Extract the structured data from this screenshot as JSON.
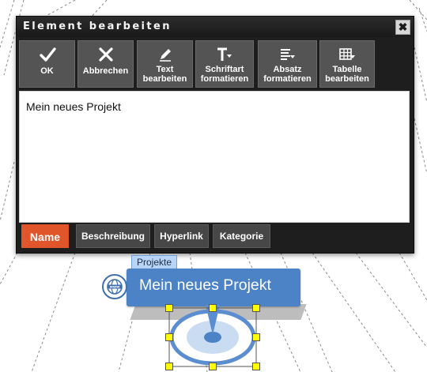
{
  "dialog": {
    "title": "Element bearbeiten",
    "toolbar": [
      {
        "id": "ok",
        "icon": "checkmark-icon",
        "label": "OK"
      },
      {
        "id": "cancel",
        "icon": "close-x-icon",
        "label": "Abbrechen"
      },
      {
        "id": "edit-text",
        "icon": "pencil-icon",
        "label": "Text\nbearbeiten"
      },
      {
        "id": "font-format",
        "icon": "text-format-icon",
        "label": "Schriftart\nformatieren"
      },
      {
        "id": "paragraph-format",
        "icon": "paragraph-format-icon",
        "label": "Absatz\nformatieren"
      },
      {
        "id": "edit-table",
        "icon": "table-icon",
        "label": "Tabelle\nbearbeiten"
      }
    ],
    "editor_text": "Mein neues Projekt",
    "tabs": [
      {
        "label": "Name",
        "active": true
      },
      {
        "label": "Beschreibung",
        "active": false
      },
      {
        "label": "Hyperlink",
        "active": false
      },
      {
        "label": "Kategorie",
        "active": false
      }
    ]
  },
  "node": {
    "category_tag": "Projekte",
    "title": "Mein neues Projekt",
    "icon": "web-globe-icon",
    "color": "#4c83c6"
  },
  "colors": {
    "active_tab": "#e0552a",
    "toolbar_button": "#545454",
    "selection_handle": "#ffff00"
  }
}
